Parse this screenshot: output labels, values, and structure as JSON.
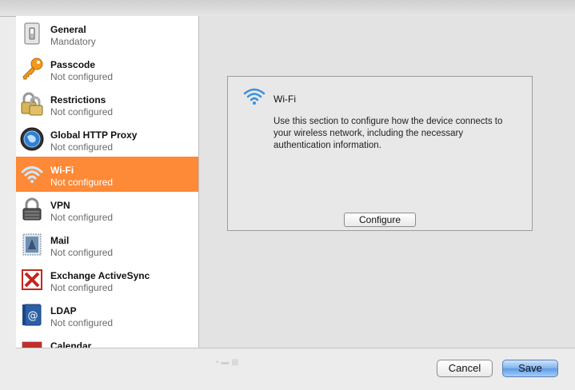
{
  "sidebar": {
    "items": [
      {
        "title": "General",
        "subtitle": "Mandatory",
        "icon": "switch-icon"
      },
      {
        "title": "Passcode",
        "subtitle": "Not configured",
        "icon": "key-icon"
      },
      {
        "title": "Restrictions",
        "subtitle": "Not configured",
        "icon": "padlocks-icon"
      },
      {
        "title": "Global HTTP Proxy",
        "subtitle": "Not configured",
        "icon": "globe-icon"
      },
      {
        "title": "Wi-Fi",
        "subtitle": "Not configured",
        "icon": "wifi-icon",
        "selected": true
      },
      {
        "title": "VPN",
        "subtitle": "Not configured",
        "icon": "vpn-lock-icon"
      },
      {
        "title": "Mail",
        "subtitle": "Not configured",
        "icon": "mail-stamp-icon"
      },
      {
        "title": "Exchange ActiveSync",
        "subtitle": "Not configured",
        "icon": "exchange-icon"
      },
      {
        "title": "LDAP",
        "subtitle": "Not configured",
        "icon": "address-book-icon"
      },
      {
        "title": "Calendar",
        "subtitle": "",
        "icon": "calendar-icon"
      }
    ]
  },
  "panel": {
    "title": "Wi-Fi",
    "description": "Use this section to configure how the device connects to your wireless network, including the necessary authentication information.",
    "configure_label": "Configure"
  },
  "footer": {
    "cancel_label": "Cancel",
    "save_label": "Save"
  },
  "colors": {
    "selection": "#fe8936",
    "save_button": "#5d9ae6"
  }
}
